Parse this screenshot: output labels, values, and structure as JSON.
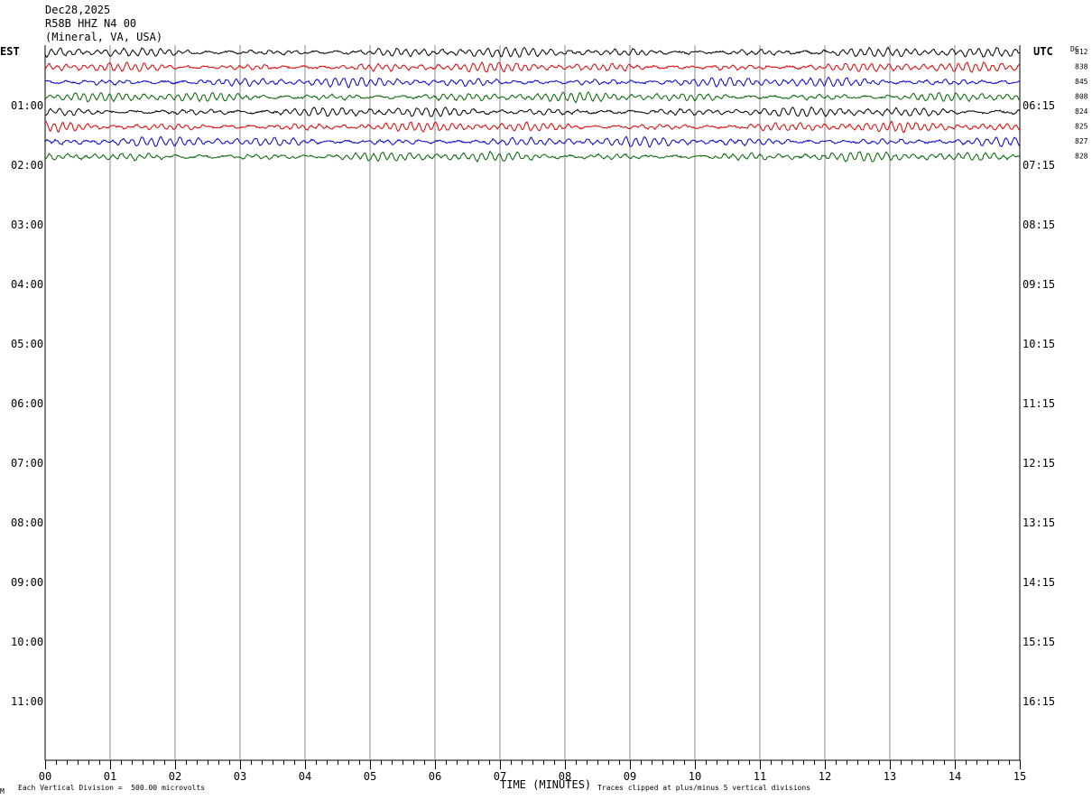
{
  "header": {
    "date": "Dec28,2025",
    "station": "R58B HHZ N4 00",
    "location": "(Mineral, VA, USA)"
  },
  "left_timezone": "EST",
  "right_timezone": "UTC",
  "dc_label": "DC",
  "chart_data": {
    "type": "line",
    "title": "",
    "xlabel": "TIME (MINUTES)",
    "xlim": [
      0,
      15
    ],
    "x_ticks": [
      "00",
      "01",
      "02",
      "03",
      "04",
      "05",
      "06",
      "07",
      "08",
      "09",
      "10",
      "11",
      "12",
      "13",
      "14",
      "15"
    ],
    "left_time_labels": [
      "01:00",
      "02:00",
      "03:00",
      "04:00",
      "05:00",
      "06:00",
      "07:00",
      "08:00",
      "09:00",
      "10:00",
      "11:00"
    ],
    "right_time_labels": [
      "06:15",
      "07:15",
      "08:15",
      "09:15",
      "10:15",
      "11:15",
      "12:15",
      "13:15",
      "14:15",
      "15:15",
      "16:15"
    ],
    "trace_colors": [
      "#000000",
      "#e00000",
      "#0000cc",
      "#006400"
    ],
    "traces_recorded": 8,
    "dc_offsets": [
      "812",
      "838",
      "845",
      "808",
      "824",
      "825",
      "827",
      "828"
    ],
    "scale_note": "Each Vertical Division =  500.00 microvolts",
    "clip_note": "Traces clipped at plus/minus 5 vertical divisions",
    "corner_mark": "M"
  }
}
